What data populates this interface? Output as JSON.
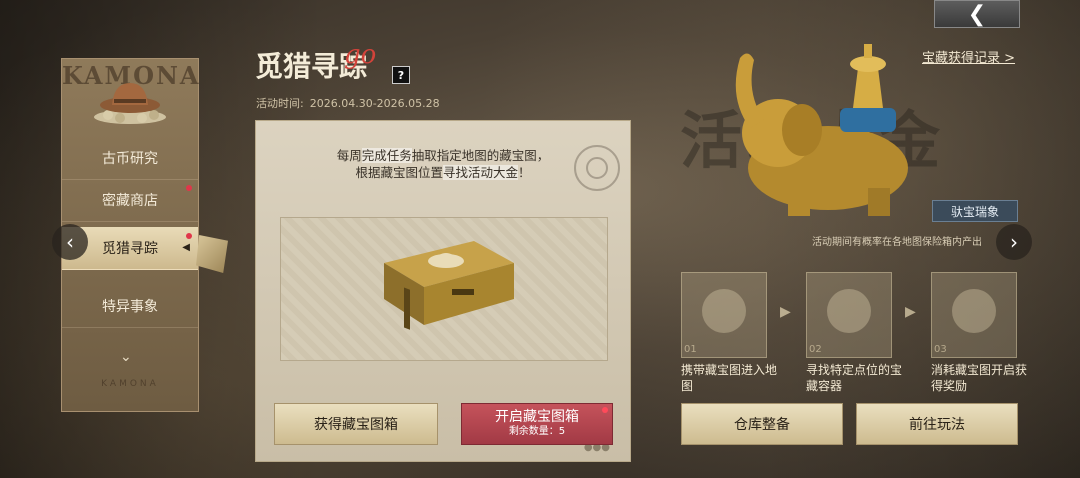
{
  "header": {
    "back_icon": "back-arrow-icon"
  },
  "sidebar": {
    "brand": "KAMONA",
    "items": [
      {
        "label": "古币研究",
        "badge": false
      },
      {
        "label": "密藏商店",
        "badge": true
      },
      {
        "label": "觅猎寻踪",
        "badge": true,
        "active": true
      },
      {
        "label": "特异事象",
        "badge": false
      }
    ],
    "footer": "KAMONA"
  },
  "event": {
    "title": "觅猎寻踪",
    "title_suffix": "go",
    "help": "?",
    "time_label": "活动时间:",
    "time_value": "2026.04.30-2026.05.28"
  },
  "panel": {
    "desc_line1_a": "每周",
    "desc_line1_hl": "完成任务",
    "desc_line1_b": "抽取指定地图的藏宝图，",
    "desc_line2_a": "根据藏宝图位置",
    "desc_line2_hl": "寻找活动大金",
    "desc_line2_b": "！",
    "get_button": "获得藏宝图箱",
    "open_button": "开启藏宝图箱",
    "remaining_label": "剩余数量：5"
  },
  "right": {
    "record_link": "宝藏获得记录 >",
    "bg_word": "活动大金",
    "treasure_name": "驮宝瑞象",
    "notice": "活动期间有概率在各地图保险箱内产出",
    "steps": [
      {
        "num": "01",
        "label": "携带藏宝图进入地图",
        "icon": "map-scroll-icon"
      },
      {
        "num": "02",
        "label": "寻找特定点位的宝藏容器",
        "icon": "map-search-icon"
      },
      {
        "num": "03",
        "label": "消耗藏宝图开启获得奖励",
        "icon": "map-reward-icon"
      }
    ],
    "warehouse_button": "仓库整备",
    "go_button": "前往玩法"
  },
  "colors": {
    "accent_red": "#a23a45",
    "gold": "#cdbb8f",
    "badge": "#e0364a"
  }
}
